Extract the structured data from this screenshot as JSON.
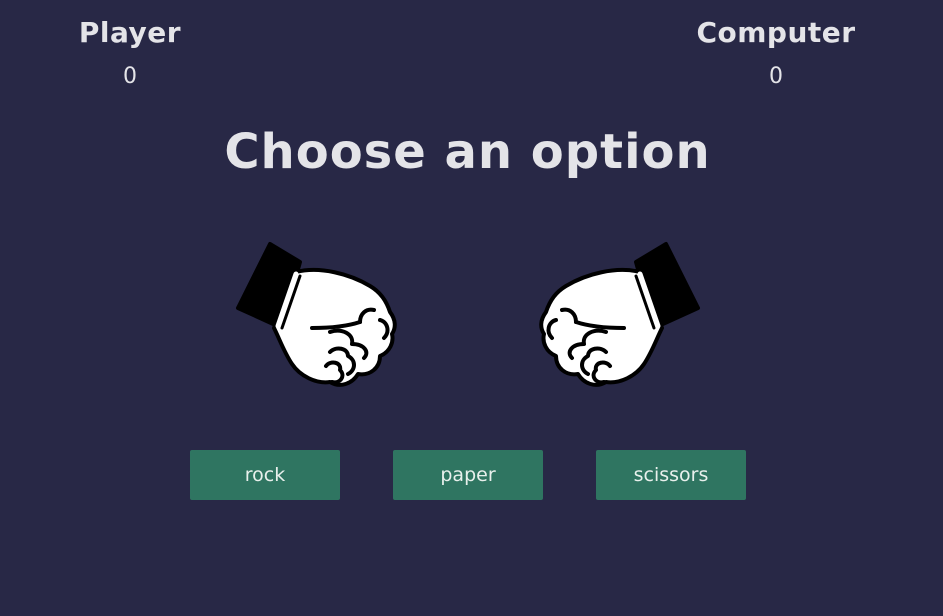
{
  "scoreboard": {
    "player": {
      "label": "Player",
      "score": "0"
    },
    "computer": {
      "label": "Computer",
      "score": "0"
    }
  },
  "headline": "Choose an option",
  "hands": {
    "player_icon": "fist-icon",
    "computer_icon": "fist-icon"
  },
  "choices": [
    {
      "label": "rock"
    },
    {
      "label": "paper"
    },
    {
      "label": "scissors"
    }
  ],
  "colors": {
    "background": "#282846",
    "text": "#e4e4e8",
    "button": "#2f7561",
    "button_text": "#e8f0ec"
  }
}
